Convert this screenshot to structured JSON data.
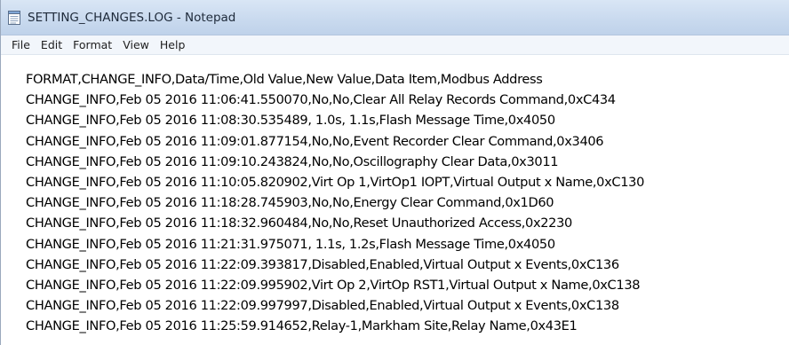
{
  "window": {
    "title": "SETTING_CHANGES.LOG - Notepad",
    "app_icon": "notepad-icon"
  },
  "menu": {
    "items": [
      "File",
      "Edit",
      "Format",
      "View",
      "Help"
    ]
  },
  "editor": {
    "lines": [
      "FORMAT,CHANGE_INFO,Data/Time,Old Value,New Value,Data Item,Modbus Address",
      "CHANGE_INFO,Feb 05 2016 11:06:41.550070,No,No,Clear All Relay Records Command,0xC434",
      "CHANGE_INFO,Feb 05 2016 11:08:30.535489, 1.0s, 1.1s,Flash Message Time,0x4050",
      "CHANGE_INFO,Feb 05 2016 11:09:01.877154,No,No,Event Recorder Clear Command,0x3406",
      "CHANGE_INFO,Feb 05 2016 11:09:10.243824,No,No,Oscillography Clear Data,0x3011",
      "CHANGE_INFO,Feb 05 2016 11:10:05.820902,Virt Op 1,VirtOp1 IOPT,Virtual Output x Name,0xC130",
      "CHANGE_INFO,Feb 05 2016 11:18:28.745903,No,No,Energy Clear Command,0x1D60",
      "CHANGE_INFO,Feb 05 2016 11:18:32.960484,No,No,Reset Unauthorized Access,0x2230",
      "CHANGE_INFO,Feb 05 2016 11:21:31.975071, 1.1s, 1.2s,Flash Message Time,0x4050",
      "CHANGE_INFO,Feb 05 2016 11:22:09.393817,Disabled,Enabled,Virtual Output x Events,0xC136",
      "CHANGE_INFO,Feb 05 2016 11:22:09.995902,Virt Op 2,VirtOp RST1,Virtual Output x Name,0xC138",
      "CHANGE_INFO,Feb 05 2016 11:22:09.997997,Disabled,Enabled,Virtual Output x Events,0xC138",
      "CHANGE_INFO,Feb 05 2016 11:25:59.914652,Relay-1,Markham Site,Relay Name,0x43E1"
    ]
  },
  "colors": {
    "titlebar": "#c8d9ee",
    "menubar": "#f2f6fb",
    "text": "#000000"
  }
}
